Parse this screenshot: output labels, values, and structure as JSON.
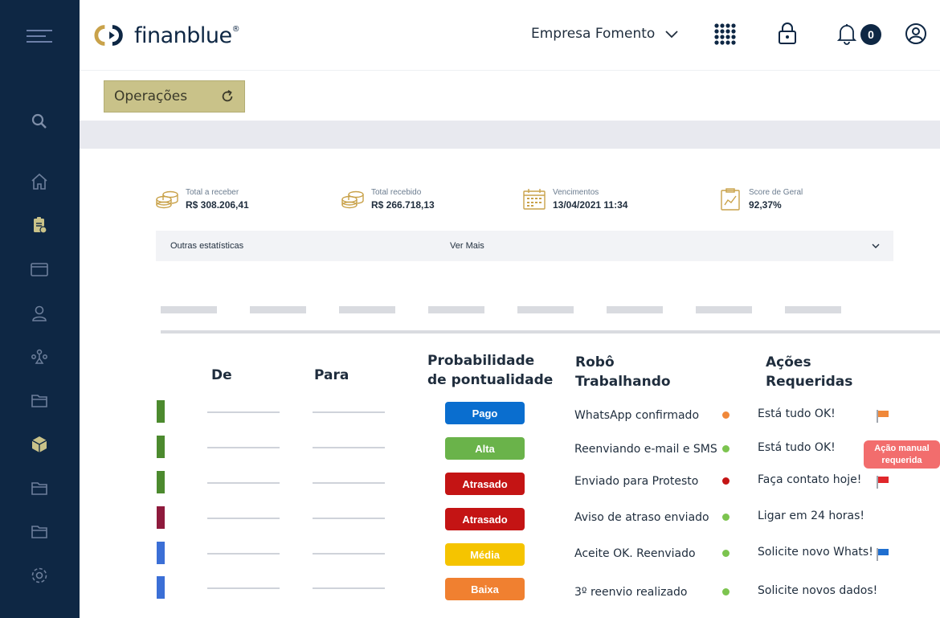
{
  "header": {
    "logo_text": "finanblue",
    "company": "Empresa Fomento",
    "notification_count": "0"
  },
  "toolbar": {
    "operations_label": "Operações"
  },
  "stats": [
    {
      "label": "Total a receber",
      "value": "R$ 308.206,41",
      "icon": "coins-icon"
    },
    {
      "label": "Total recebido",
      "value": "R$ 266.718,13",
      "icon": "coins-icon"
    },
    {
      "label": "Vencimentos",
      "value": "13/04/2021 11:34",
      "icon": "calendar-icon"
    },
    {
      "label": "Score de Geral",
      "value": "92,37%",
      "icon": "chart-clipboard-icon"
    }
  ],
  "more_stats": {
    "label": "Outras estatísticas",
    "link": "Ver Mais"
  },
  "table": {
    "headers": {
      "from": "De",
      "to": "Para",
      "prob_line1": "Probabilidade",
      "prob_line2": "de pontualidade",
      "robot_line1": "Robô",
      "robot_line2": "Trabalhando",
      "actions_line1": "Ações",
      "actions_line2": "Requeridas"
    },
    "rows": [
      {
        "status_color": "#4c8a2e",
        "prob": "Pago",
        "prob_color": "#0a6ecf",
        "robot": "WhatsApp confirmado",
        "dot_color": "#f0883a",
        "action": "Está tudo OK!",
        "flag_color": "#f0883a"
      },
      {
        "status_color": "#4c8a2e",
        "prob": "Alta",
        "prob_color": "#6ab34a",
        "robot": "Reenviando e-mail e SMS",
        "dot_color": "#7cc44f",
        "action": "Está tudo OK!",
        "flag_color": ""
      },
      {
        "status_color": "#4c8a2e",
        "prob": "Atrasado",
        "prob_color": "#c41414",
        "robot": "Enviado para Protesto",
        "dot_color": "#c41414",
        "action": "Faça contato hoje!",
        "flag_color": "#e0272b"
      },
      {
        "status_color": "#8e1a3c",
        "prob": "Atrasado",
        "prob_color": "#c41414",
        "robot": "Aviso de atraso enviado",
        "dot_color": "#7cc44f",
        "action": "Ligar em 24 horas!",
        "flag_color": ""
      },
      {
        "status_color": "#3b6fd6",
        "prob": "Média",
        "prob_color": "#f5c400",
        "robot": "Aceite OK. Reenviado",
        "dot_color": "#7cc44f",
        "action": "Solicite novo Whats!",
        "flag_color": "#1f6fd0"
      },
      {
        "status_color": "#3b6fd6",
        "prob": "Baixa",
        "prob_color": "#f08030",
        "robot": "3º reenvio realizado",
        "dot_color": "#7cc44f",
        "action": "Solicite novos dados!",
        "flag_color": ""
      }
    ]
  },
  "tooltip": {
    "line1": "Ação manual",
    "line2": "requerida"
  },
  "colors": {
    "sidebar": "#0e2744",
    "accent": "#c9c289",
    "brand": "#0e2744"
  }
}
